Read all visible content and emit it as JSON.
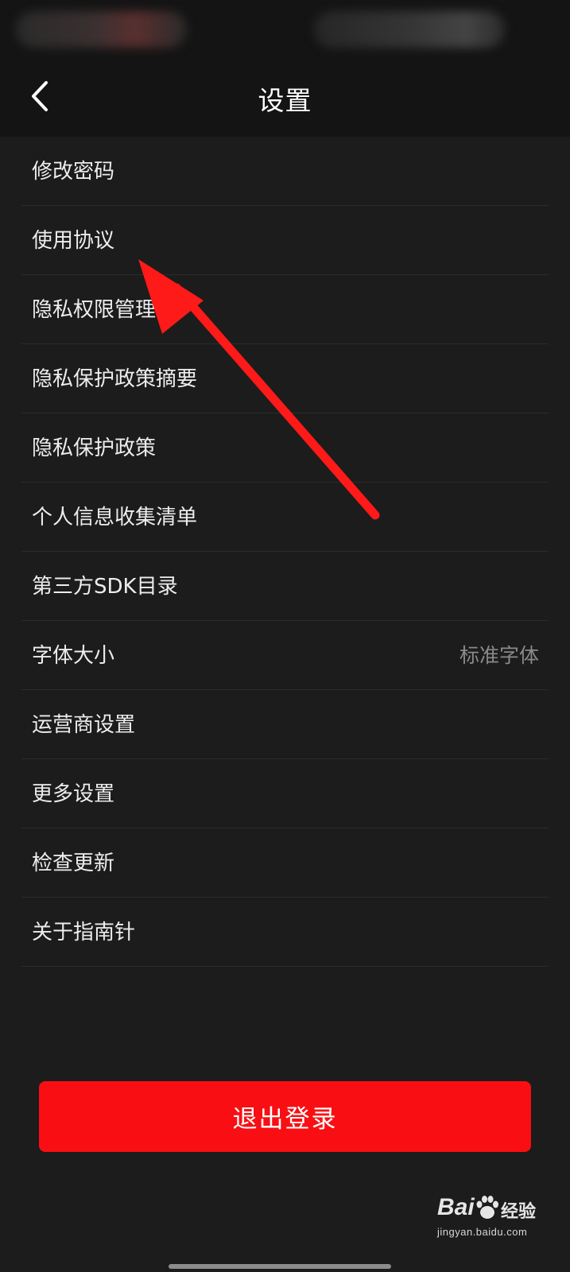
{
  "header": {
    "title": "设置",
    "back_icon": "chevron-left-icon"
  },
  "settings": {
    "items": [
      {
        "label": "修改密码"
      },
      {
        "label": "使用协议"
      },
      {
        "label": "隐私权限管理"
      },
      {
        "label": "隐私保护政策摘要"
      },
      {
        "label": "隐私保护政策"
      },
      {
        "label": "个人信息收集清单"
      },
      {
        "label": "第三方SDK目录"
      },
      {
        "label": "字体大小",
        "value": "标准字体"
      },
      {
        "label": "运营商设置"
      },
      {
        "label": "更多设置"
      },
      {
        "label": "检查更新"
      },
      {
        "label": "关于指南针"
      }
    ]
  },
  "logout": {
    "label": "退出登录"
  },
  "watermark": {
    "brand": "Bai",
    "brand_suffix": "经验",
    "url": "jingyan.baidu.com"
  },
  "colors": {
    "background": "#1c1c1c",
    "header_background": "#141414",
    "accent_red": "#f90f13",
    "annotation_arrow": "#ff1a1a",
    "secondary_text": "#8a8a8a"
  }
}
